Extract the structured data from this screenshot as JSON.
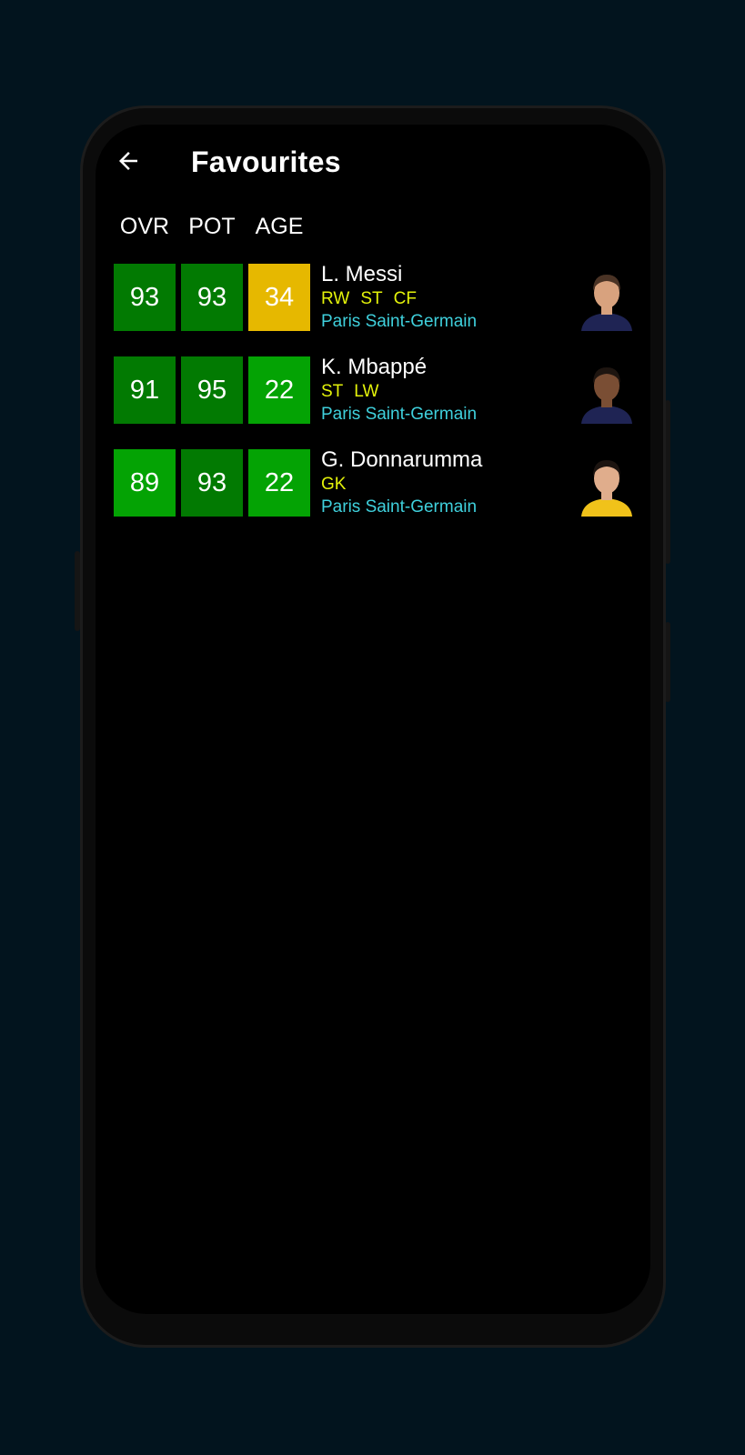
{
  "header": {
    "title": "Favourites"
  },
  "columns": [
    "OVR",
    "POT",
    "AGE"
  ],
  "players": [
    {
      "name": "L. Messi",
      "ovr": "93",
      "pot": "93",
      "age": "34",
      "positions": [
        "RW",
        "ST",
        "CF"
      ],
      "club": "Paris Saint-Germain",
      "colors": {
        "ovr": "#027a02",
        "pot": "#027a02",
        "age": "#e6b800"
      },
      "avatar": {
        "skin": "#d8a27e",
        "hair": "#4a3325",
        "shirt": "#1f2454"
      }
    },
    {
      "name": "K. Mbappé",
      "ovr": "91",
      "pot": "95",
      "age": "22",
      "positions": [
        "ST",
        "LW"
      ],
      "club": "Paris Saint-Germain",
      "colors": {
        "ovr": "#027a02",
        "pot": "#027a02",
        "age": "#04a304"
      },
      "avatar": {
        "skin": "#7a4e34",
        "hair": "#1e1510",
        "shirt": "#1f2454"
      }
    },
    {
      "name": "G. Donnarumma",
      "ovr": "89",
      "pot": "93",
      "age": "22",
      "positions": [
        "GK"
      ],
      "club": "Paris Saint-Germain",
      "colors": {
        "ovr": "#04a304",
        "pot": "#027a02",
        "age": "#04a304"
      },
      "avatar": {
        "skin": "#e0ad8c",
        "hair": "#1c1410",
        "shirt": "#f0c21a"
      }
    }
  ]
}
